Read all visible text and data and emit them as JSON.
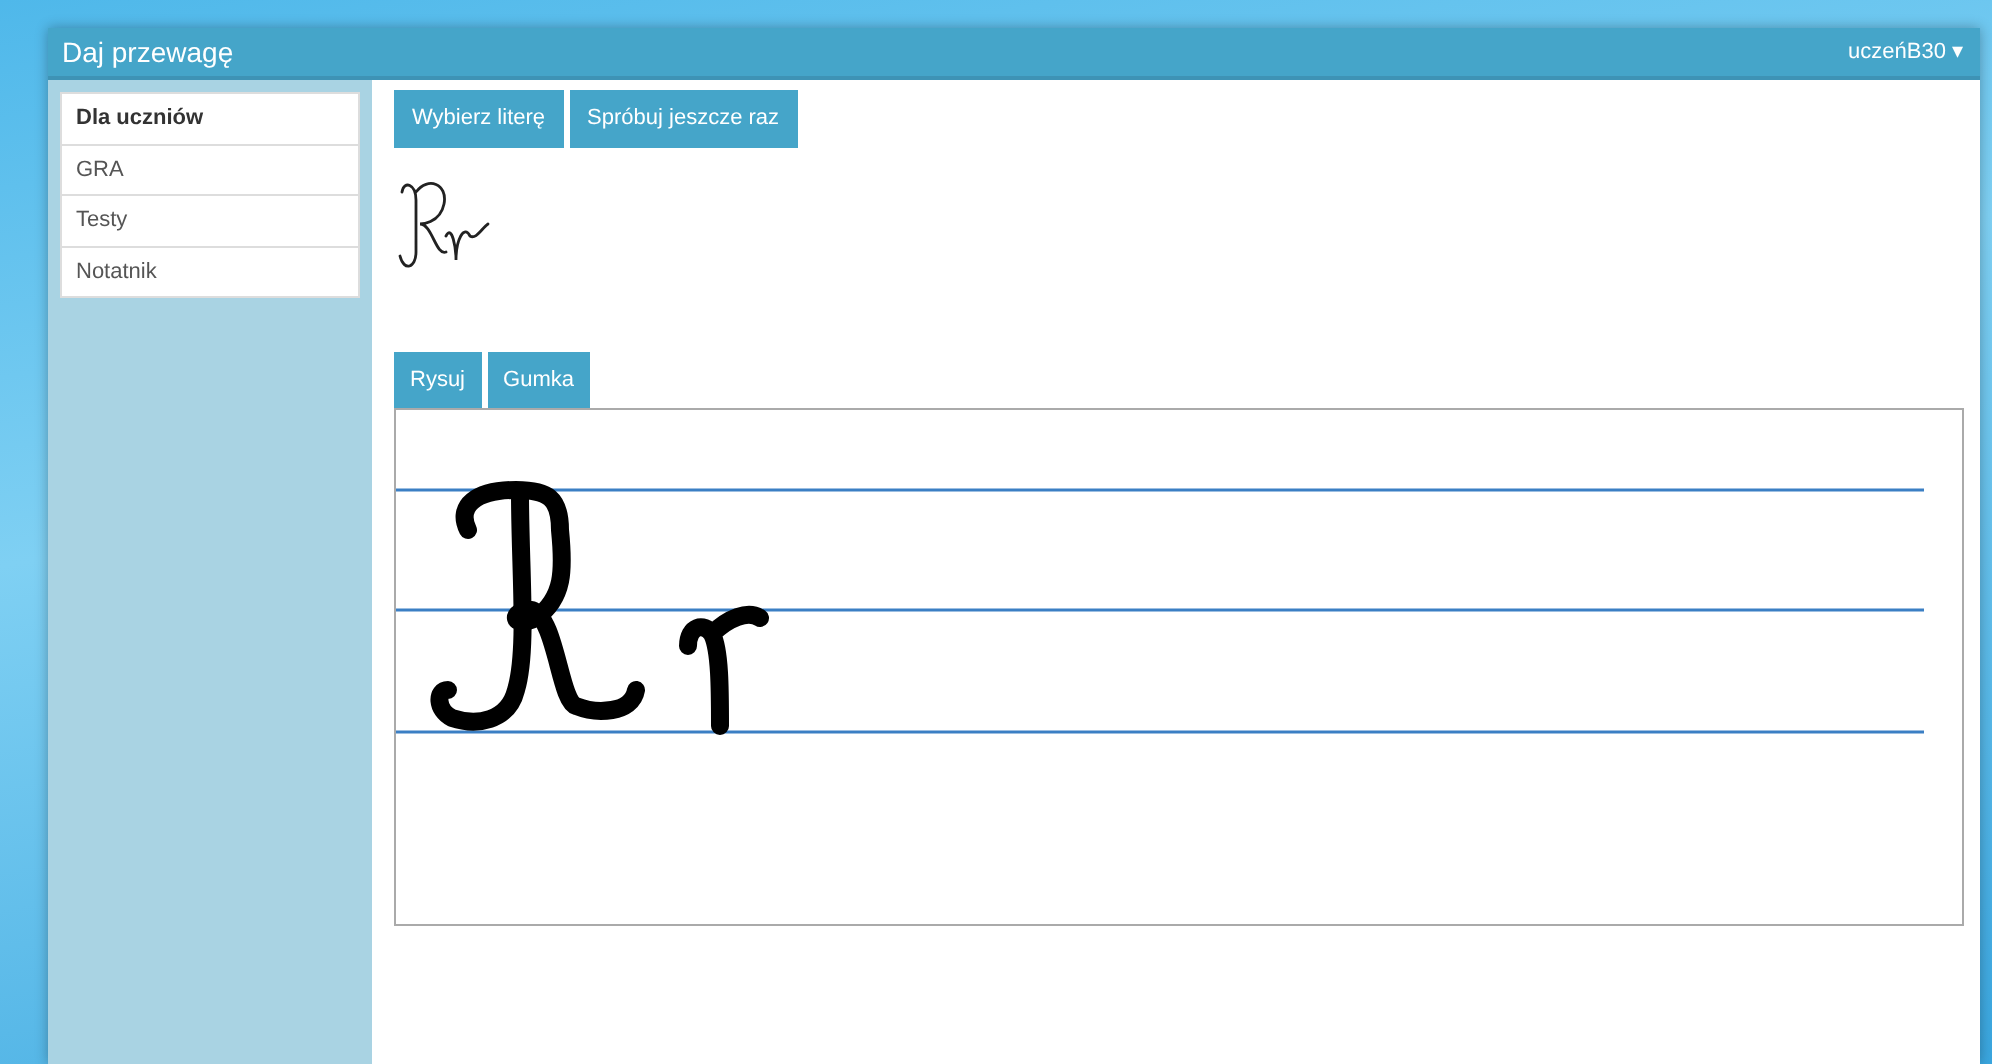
{
  "window": {
    "title": "Daj przewagę"
  },
  "user_menu": {
    "label": "uczeńB30",
    "caret": "▾"
  },
  "sidebar": {
    "items": [
      {
        "label": "Dla uczniów",
        "selected": true
      },
      {
        "label": "GRA",
        "selected": false
      },
      {
        "label": "Testy",
        "selected": false
      },
      {
        "label": "Notatnik",
        "selected": false
      }
    ]
  },
  "toolbar": {
    "buttons": [
      "Wybierz literę",
      "Spróbuj jeszcze raz"
    ]
  },
  "tool_tabs": [
    {
      "label": "Rysuj",
      "selected": false
    },
    {
      "label": "Gumka",
      "selected": false
    }
  ]
}
